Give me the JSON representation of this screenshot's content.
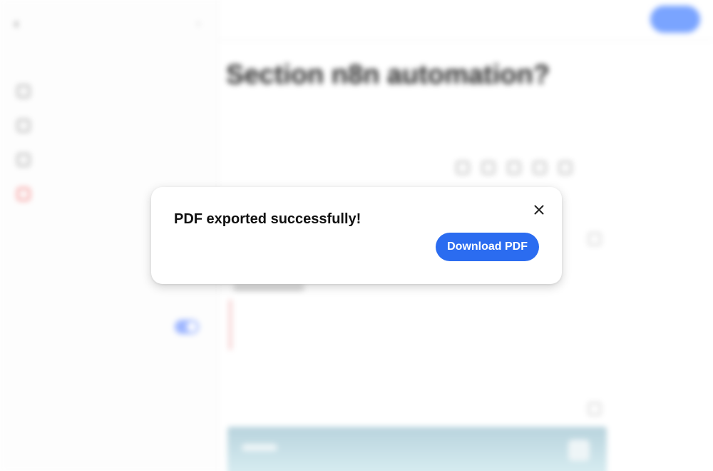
{
  "sidebar": {
    "title": "",
    "nav_items": [
      {
        "label": "",
        "icon": "copy-icon"
      },
      {
        "label": "",
        "icon": "share-icon"
      },
      {
        "label": "",
        "icon": "export-icon"
      },
      {
        "label": "",
        "icon": "trash-icon"
      }
    ],
    "section_title": "",
    "subtitle": "",
    "description": ""
  },
  "main": {
    "page_title": "Section n8n automation?",
    "export_label": ""
  },
  "toast": {
    "message": "PDF exported successfully!",
    "download_label": "Download PDF",
    "close_icon": "close-icon",
    "accent_color": "#2b6cf0"
  }
}
